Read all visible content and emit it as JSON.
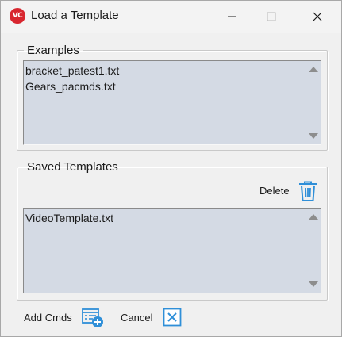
{
  "window": {
    "title": "Load a Template",
    "app_icon_text": "VC",
    "accent_color": "#2f8fd8",
    "icon_color": "#d8262f"
  },
  "examples": {
    "legend": "Examples",
    "items": [
      "bracket_patest1.txt",
      "Gears_pacmds.txt"
    ]
  },
  "saved_templates": {
    "legend": "Saved Templates",
    "delete_label": "Delete",
    "items": [
      "VideoTemplate.txt"
    ]
  },
  "footer": {
    "add_cmds_label": "Add Cmds",
    "cancel_label": "Cancel"
  },
  "icons": {
    "app": "app-logo-icon",
    "minimize": "minimize-icon",
    "maximize": "maximize-icon",
    "close": "close-icon",
    "delete": "trash-icon",
    "add_cmds": "add-list-icon",
    "cancel": "cancel-x-icon"
  }
}
